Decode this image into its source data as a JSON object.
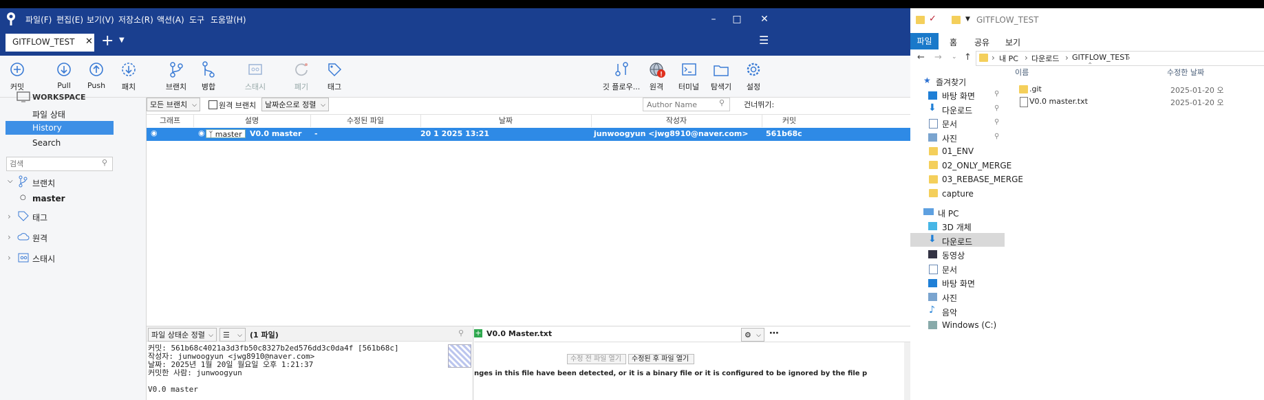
{
  "sourcetree": {
    "menu": [
      "파일(F)",
      "편집(E)",
      "보기(V)",
      "저장소(R)",
      "액션(A)",
      "도구",
      "도움말(H)"
    ],
    "tab_label": "GITFLOW_TEST",
    "toolbar": {
      "commit": "커밋",
      "pull": "Pull",
      "push": "Push",
      "fetch": "패치",
      "branch": "브랜치",
      "merge": "병합",
      "stash": "스태시",
      "discard": "폐기",
      "tag": "태그",
      "gitflow": "깃 플로우...",
      "remote": "원격",
      "terminal": "터미널",
      "explorer": "탐색기",
      "settings": "설정"
    },
    "sidebar": {
      "workspace": "WORKSPACE",
      "file_status": "파일 상태",
      "history": "History",
      "search": "Search",
      "search_placeholder": "검색",
      "branches": "브랜치",
      "master": "master",
      "tags": "태그",
      "remotes": "원격",
      "stashes": "스태시"
    },
    "filters": {
      "all_branches": "모든 브랜치",
      "remote_branches": "원격 브랜치",
      "sort_by_date": "날짜순으로 정렬",
      "author_placeholder": "Author Name",
      "skip": "건너뛰기:"
    },
    "columns": [
      "그래프",
      "설명",
      "수정된 파일",
      "날짜",
      "작성자",
      "커밋"
    ],
    "commit_row": {
      "branch_tag": "master",
      "description": "V0.0 master",
      "files": "-",
      "date": "20 1 2025 13:21",
      "author": "junwoogyun <jwg8910@naver.com>",
      "hash": "561b68c"
    },
    "bottom": {
      "sort_label": "파일 상태순 정렬",
      "file_count": "(1 파일)",
      "file_name": "V0.0 Master.txt",
      "commit_line": "커밋: 561b68c4021a3d3fb50c8327b2ed576dd3c0da4f [561b68c]",
      "author_line": "작성자: junwoogyun <jwg8910@naver.com>",
      "date_line": "날짜: 2025년 1월 20일 월요일 오후 1:21:37",
      "committer_line": "커밋한 사람: junwoogyun",
      "message": "V0.0 master",
      "open_before": "수정 전 파일 열기",
      "open_after": "수정된 후 파일 열기",
      "binary_notice": "nges in this file have been detected, or it is a binary file or it is configured to be ignored by the file p"
    }
  },
  "explorer": {
    "title": "GITFLOW_TEST",
    "ribbon": [
      "파일",
      "홈",
      "공유",
      "보기"
    ],
    "breadcrumb": [
      "내 PC",
      "다운로드",
      "GITFLOW_TEST"
    ],
    "col_name": "이름",
    "col_modified": "수정한 날짜",
    "nav": [
      "즐겨찾기",
      "바탕 화면",
      "다운로드",
      "문서",
      "사진",
      "01_ENV",
      "02_ONLY_MERGE",
      "03_REBASE_MERGE",
      "capture",
      "내 PC",
      "3D 개체",
      "다운로드",
      "동영상",
      "문서",
      "바탕 화면",
      "사진",
      "음악",
      "Windows (C:)"
    ],
    "files": [
      {
        "name": ".git",
        "date": "2025-01-20 오"
      },
      {
        "name": "V0.0 master.txt",
        "date": "2025-01-20 오"
      }
    ]
  },
  "colors": {
    "title_blue": "#1a3f8f",
    "selection": "#2e8ae6",
    "folder": "#f4cf5b"
  }
}
